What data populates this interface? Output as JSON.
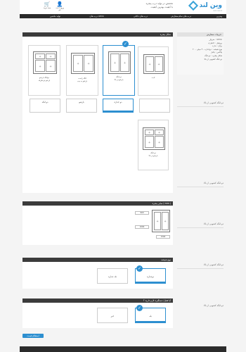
{
  "header": {
    "brand": "وین لند",
    "brand_tagline": "win land",
    "slogan_line1": "تخصص در تولید درب پنجره",
    "slogan_line2": "با کیفیت بهترین کیفیت",
    "icons": [
      {
        "name": "cart-icon",
        "label": "سبد خرید"
      },
      {
        "name": "user-icon",
        "label": "ورود / ثبت نام"
      }
    ]
  },
  "nav": {
    "items": [
      "ویترین",
      "درب های تمام سفارش",
      "درب های داخلی",
      "درب های UPVC",
      "تولید ماشین"
    ]
  },
  "specs": {
    "title": "جزییات سفارش",
    "rows": [
      "متریال : UPVC",
      "پروفیل : اختیاری",
      "یراق : ندارد",
      "نوع شیشه : دوجداره - ۴ میلی - ۲۰",
      "پلاکس : یکبار",
      "شکل پنجره : دو لنگه",
      "دو لنگه کشویی از بالا"
    ]
  },
  "sections": {
    "shape": {
      "title": "شکل پنجره"
    },
    "size": {
      "title": "سایز پنجره ( mm )"
    },
    "glass": {
      "title": "نوع شیشه"
    },
    "lock": {
      "title": "آیا قفل/ دستگیره لازم دارید ؟"
    }
  },
  "windows": [
    {
      "label": "ثابت",
      "sub": "",
      "selected": false
    },
    {
      "label": "دو لنگه",
      "sub": "بازشو از بالا",
      "selected": true
    },
    {
      "label": "لنگه راست",
      "sub": "بازشو به چپ",
      "selected": false
    },
    {
      "label": "بازشو",
      "sub": "بازشو از بالا",
      "selected": false
    },
    {
      "label": "دولنگه بازشو",
      "sub": "بازشو دو طرفه",
      "selected": false
    }
  ],
  "windows_extra": {
    "label": "دو لنگه",
    "sub": "بازشو از بالا"
  },
  "slots": [
    "دو لنگه",
    "بازشو",
    "دو جداره"
  ],
  "size_fields": [
    "900",
    "1000",
    "1500"
  ],
  "glass_options": [
    "دوجداره",
    "تک جداره"
  ],
  "lock_options": [
    "بله",
    "خیر"
  ],
  "side_notes": [
    "دو لنگه کشویی از بالا",
    "دو لنگه کشویی از بالا",
    "دو لنگه کشویی از بالا",
    "دو لنگه کشویی از بالا",
    "دو لنگه کشویی از بالا"
  ],
  "submit_label": "استعلام قیمت",
  "colors": {
    "accent": "#2d8fd0",
    "header_bg": "#3b3b3b"
  }
}
